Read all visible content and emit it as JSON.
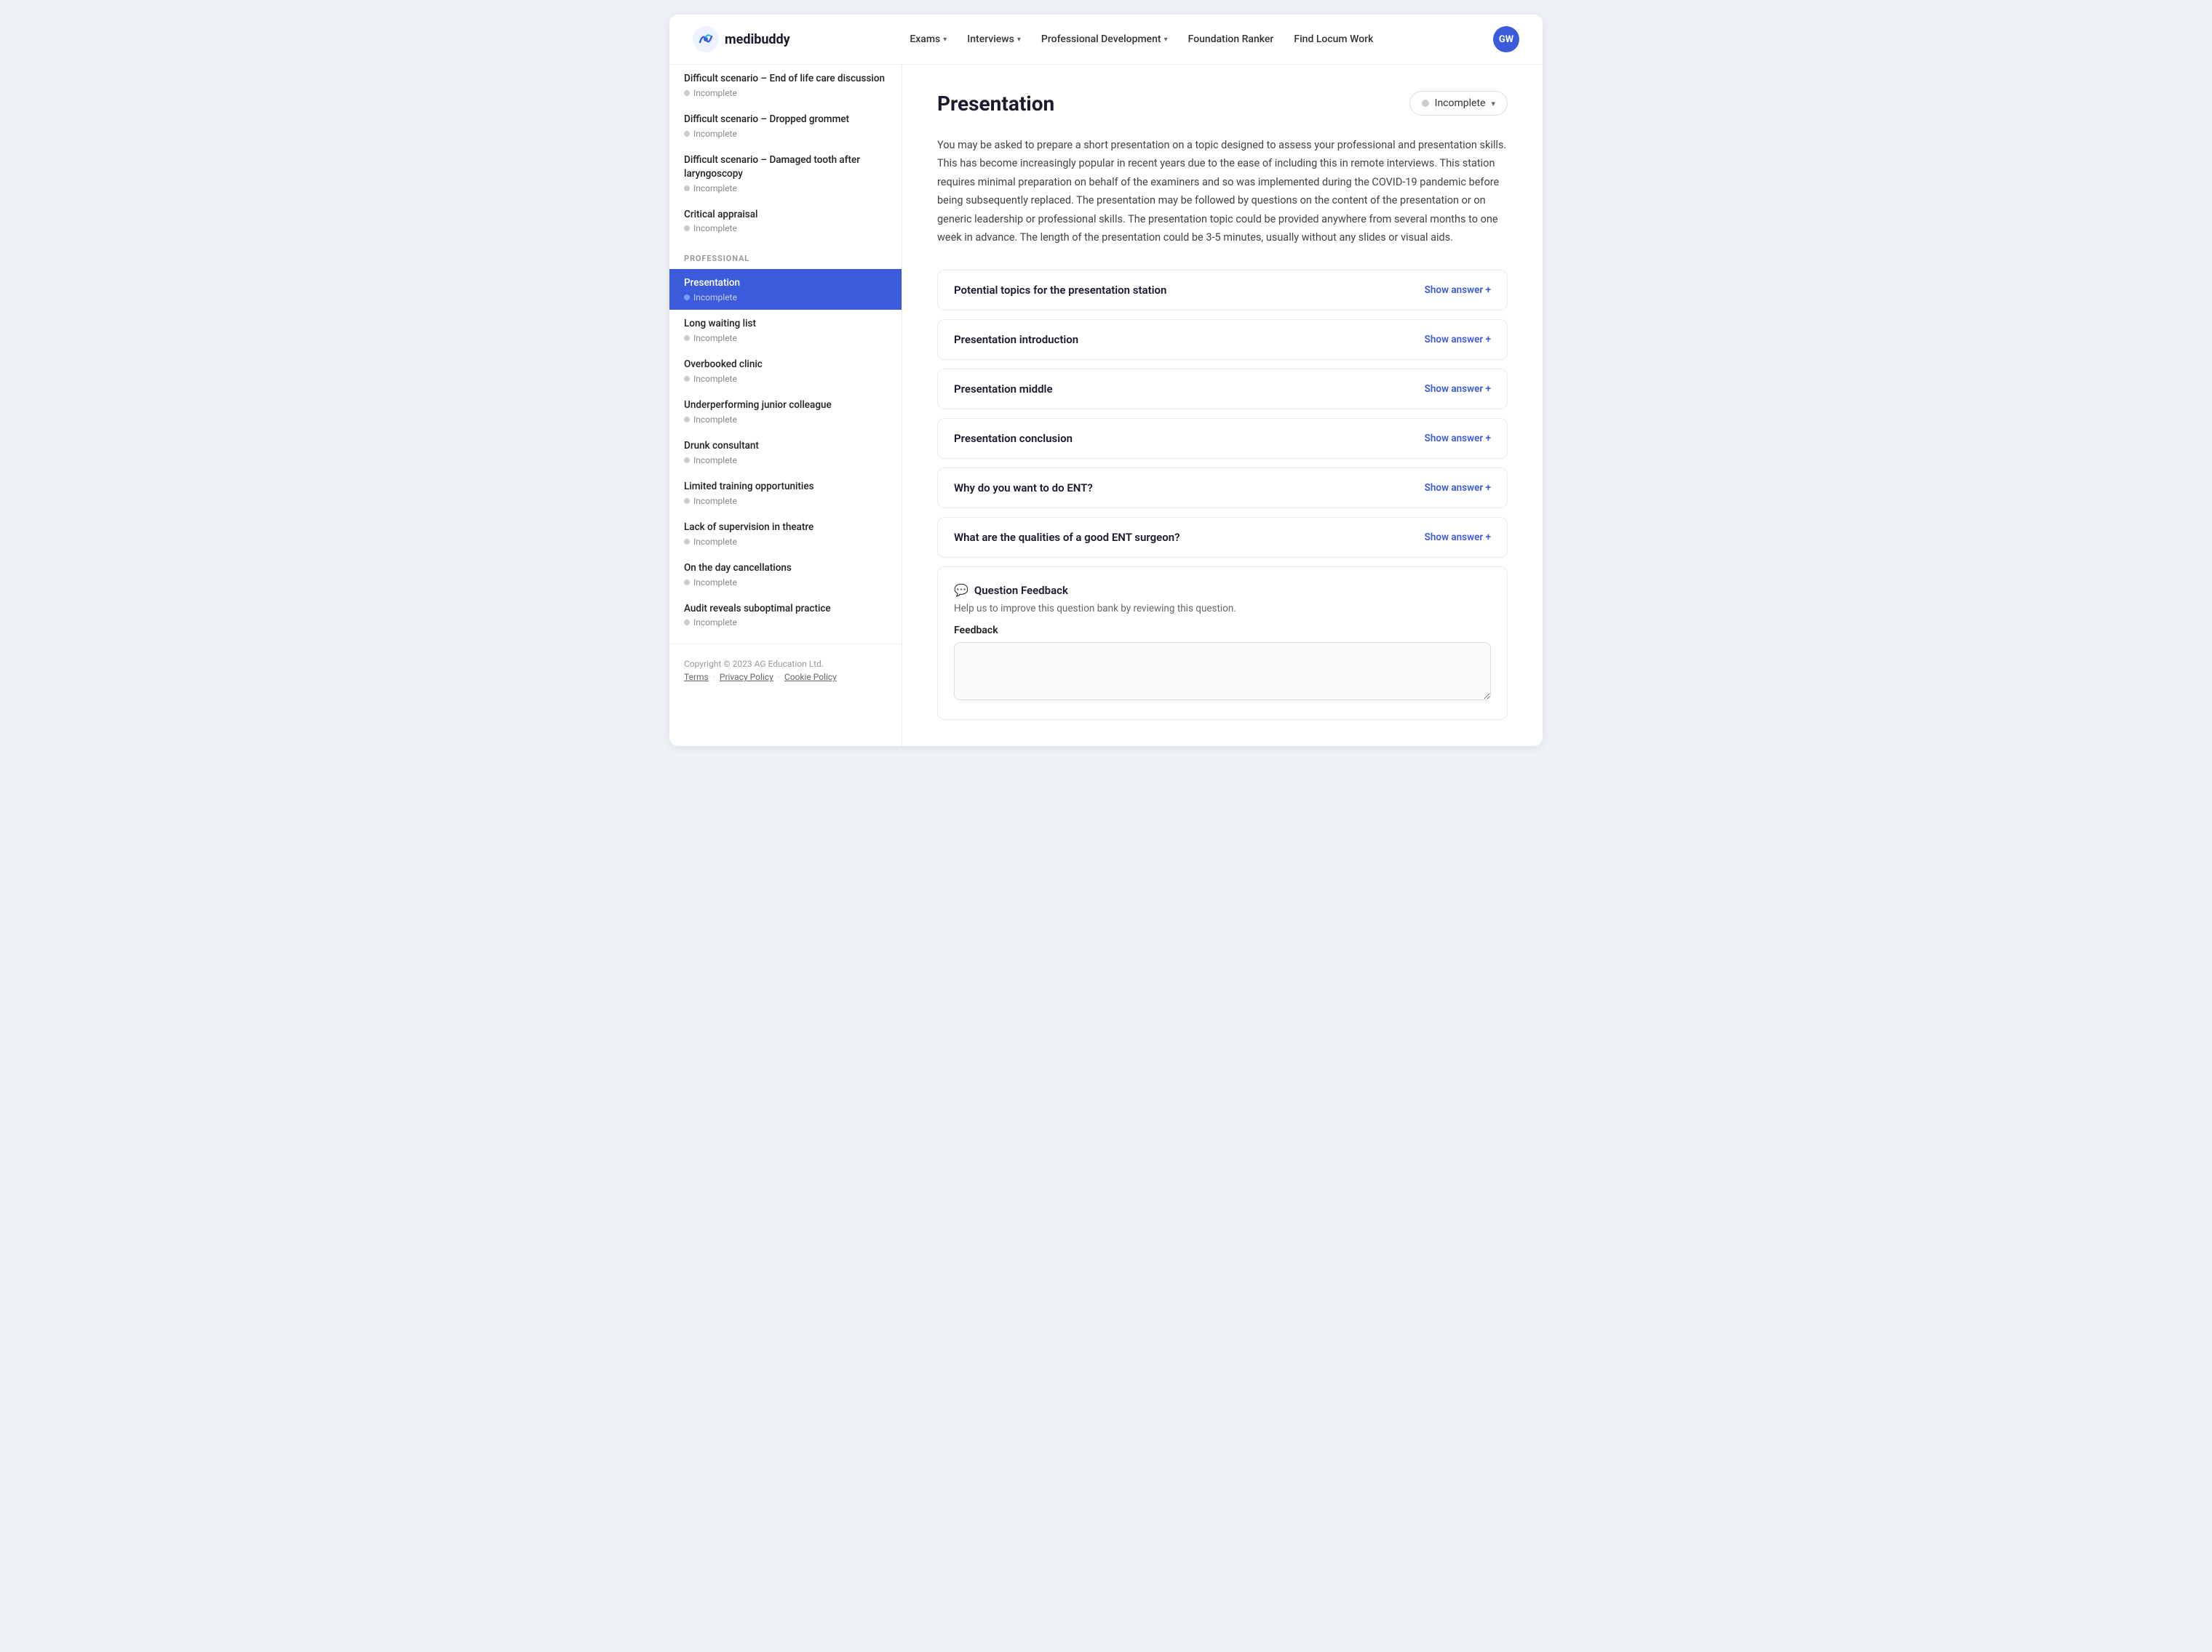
{
  "header": {
    "logo_text": "medibuddy",
    "nav_items": [
      {
        "label": "Exams",
        "has_dropdown": true
      },
      {
        "label": "Interviews",
        "has_dropdown": true
      },
      {
        "label": "Professional Development",
        "has_dropdown": true
      },
      {
        "label": "Foundation Ranker",
        "has_dropdown": false
      },
      {
        "label": "Find Locum Work",
        "has_dropdown": false
      }
    ],
    "avatar_initials": "GW"
  },
  "sidebar": {
    "section_label": "Professional",
    "items_above": [
      {
        "title": "Difficult scenario – End of life care discussion",
        "status": "Incomplete"
      },
      {
        "title": "Difficult scenario – Dropped grommet",
        "status": "Incomplete"
      },
      {
        "title": "Difficult scenario – Damaged tooth after laryngoscopy",
        "status": "Incomplete"
      },
      {
        "title": "Critical appraisal",
        "status": "Incomplete"
      }
    ],
    "items": [
      {
        "title": "Presentation",
        "status": "Incomplete",
        "active": true
      },
      {
        "title": "Long waiting list",
        "status": "Incomplete"
      },
      {
        "title": "Overbooked clinic",
        "status": "Incomplete"
      },
      {
        "title": "Underperforming junior colleague",
        "status": "Incomplete"
      },
      {
        "title": "Drunk consultant",
        "status": "Incomplete"
      },
      {
        "title": "Limited training opportunities",
        "status": "Incomplete"
      },
      {
        "title": "Lack of supervision in theatre",
        "status": "Incomplete"
      },
      {
        "title": "On the day cancellations",
        "status": "Incomplete"
      },
      {
        "title": "Audit reveals suboptimal practice",
        "status": "Incomplete"
      }
    ],
    "footer": {
      "copyright": "Copyright © 2023 AG Education Ltd.",
      "links": [
        "Terms",
        "Privacy Policy",
        "Cookie Policy"
      ]
    }
  },
  "main": {
    "title": "Presentation",
    "status_label": "Incomplete",
    "description": "You may be asked to prepare a short presentation on a topic designed to assess your professional and presentation skills. This has become increasingly popular in recent years due to the ease of including this in remote interviews. This station requires minimal preparation on behalf of the examiners and so was implemented during the COVID-19 pandemic before being subsequently replaced. The presentation may be followed by questions on the content of the presentation or on generic leadership or professional skills. The presentation topic could be provided anywhere from several months to one week in advance. The length of the presentation could be 3-5 minutes, usually without any slides or visual aids.",
    "accordion_items": [
      {
        "title": "Potential topics for the presentation station",
        "action": "Show answer +"
      },
      {
        "title": "Presentation introduction",
        "action": "Show answer +"
      },
      {
        "title": "Presentation middle",
        "action": "Show answer +"
      },
      {
        "title": "Presentation conclusion",
        "action": "Show answer +"
      },
      {
        "title": "Why do you want to do ENT?",
        "action": "Show answer +"
      },
      {
        "title": "What are the qualities of a good ENT surgeon?",
        "action": "Show answer +"
      }
    ],
    "feedback": {
      "title": "Question Feedback",
      "subtitle": "Help us to improve this question bank by reviewing this question.",
      "label": "Feedback",
      "placeholder": ""
    }
  }
}
